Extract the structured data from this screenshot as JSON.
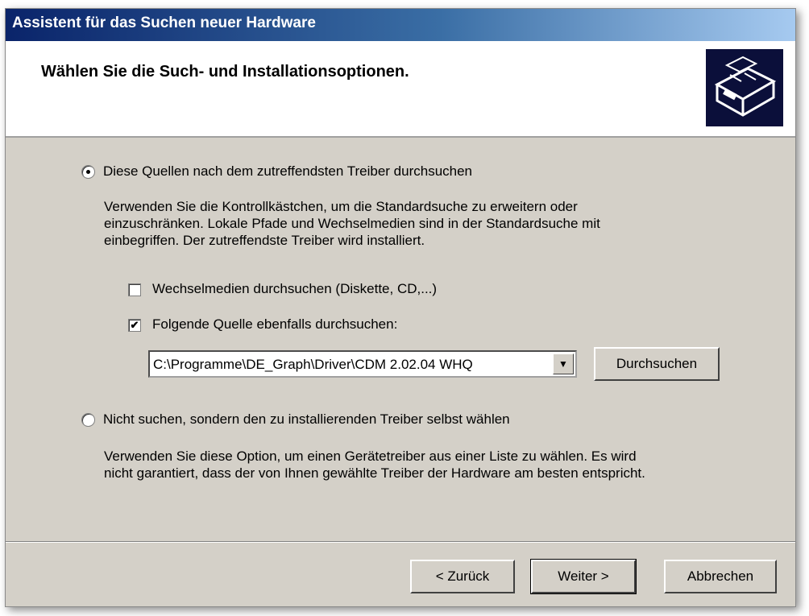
{
  "window": {
    "title": "Assistent für das Suchen neuer Hardware"
  },
  "header": {
    "title": "Wählen Sie die Such- und Installationsoptionen.",
    "icon": "hardware-icon"
  },
  "options": {
    "search": {
      "label": "Diese Quellen nach dem zutreffendsten Treiber durchsuchen",
      "selected": true,
      "description": [
        "Verwenden Sie die Kontrollkästchen, um die Standardsuche zu erweitern oder",
        "einzuschränken. Lokale Pfade und Wechselmedien sind in der Standardsuche mit",
        "einbegriffen. Der zutreffendste Treiber wird installiert."
      ],
      "removable_media": {
        "label": "Wechselmedien durchsuchen (Diskette, CD,...)",
        "checked": false
      },
      "include_location": {
        "label": "Folgende Quelle ebenfalls durchsuchen:",
        "checked": true
      },
      "path": "C:\\Programme\\DE_Graph\\Driver\\CDM 2.02.04 WHQ",
      "browse_label": "Durchsuchen"
    },
    "manual": {
      "label": "Nicht suchen, sondern den zu installierenden Treiber selbst wählen",
      "selected": false,
      "description": [
        "Verwenden Sie diese Option, um einen Gerätetreiber aus einer Liste zu wählen. Es wird",
        "nicht garantiert, dass der von Ihnen gewählte Treiber der Hardware am besten entspricht."
      ]
    }
  },
  "buttons": {
    "back": "< Zurück",
    "next": "Weiter >",
    "cancel": "Abbrechen"
  }
}
